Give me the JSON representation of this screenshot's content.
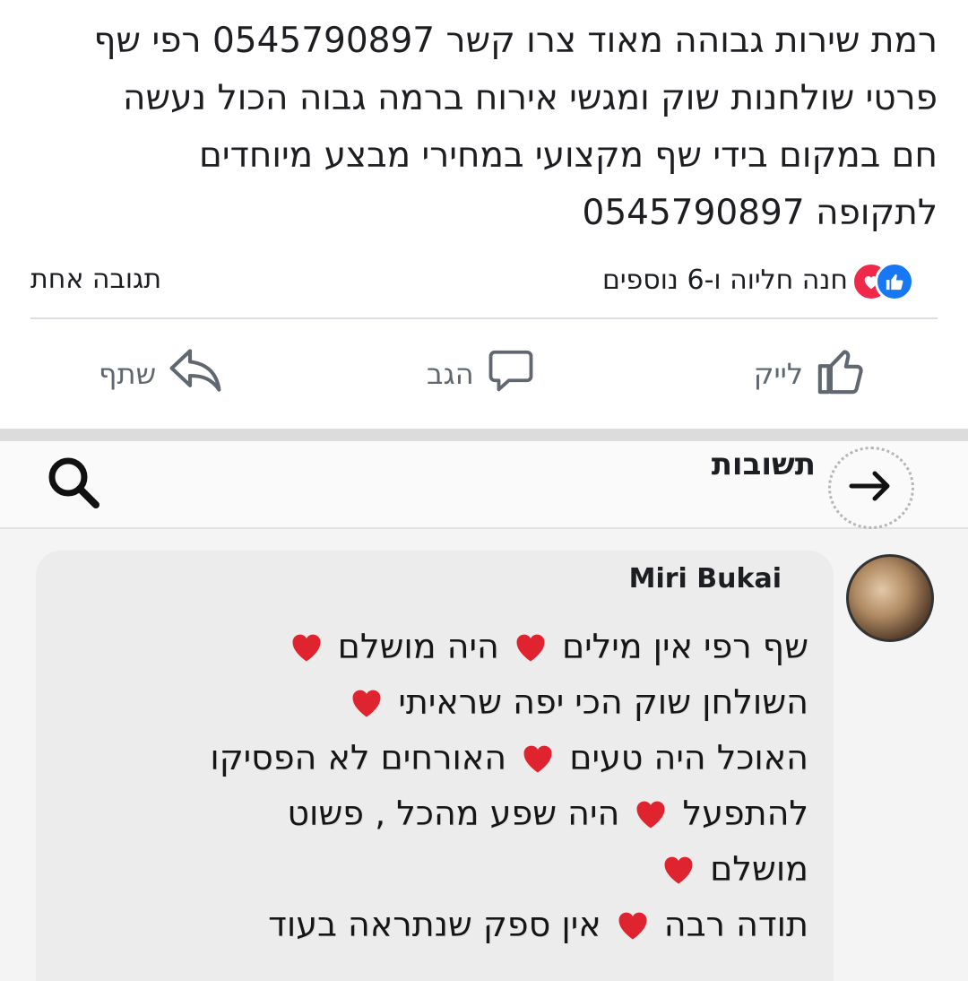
{
  "post": {
    "lines": [
      "רמת שירות גבוהה מאוד  צרו קשר 0545790897 רפי שף",
      "פרטי שולחנות שוק ומגשי אירוח ברמה גבוה הכול נעשה",
      "חם במקום בידי שף מקצועי במחירי מבצע מיוחדים",
      "לתקופה 0545790897"
    ],
    "reactions_text": "חנה חליוה ו-6 נוספים",
    "comments_count": "תגובה אחת",
    "actions": {
      "like": "לייק",
      "comment": "הגב",
      "share": "שתף"
    }
  },
  "screenshot": {
    "header_title": "תשובות",
    "comment": {
      "author": "Miri Bukai",
      "segments": [
        [
          "שף רפי אין מילים ",
          "heart",
          " היה מושלם ",
          "heart"
        ],
        [
          "השולחן שוק הכי יפה שראיתי ",
          "heart"
        ],
        [
          "האוכל היה טעים ",
          "heart",
          " האורחים לא הפסיקו"
        ],
        [
          "להתפעל ",
          "heart",
          " היה שפע מהכל , פשוט"
        ],
        [
          "מושלם ",
          "heart"
        ],
        [
          "תודה רבה ",
          "heart",
          " אין ספק שנתראה בעוד"
        ]
      ]
    }
  },
  "colors": {
    "like_blue": "#1877f2",
    "love_red": "#f02849",
    "heart_red": "#e0242f",
    "action_gray": "#606770"
  },
  "icons": {
    "like_reaction": "thumbs-up-icon",
    "love_reaction": "heart-icon",
    "like_action": "thumbs-up-outline-icon",
    "comment_action": "speech-bubble-icon",
    "share_action": "share-arrow-icon",
    "back": "arrow-right-icon",
    "search": "search-icon"
  }
}
